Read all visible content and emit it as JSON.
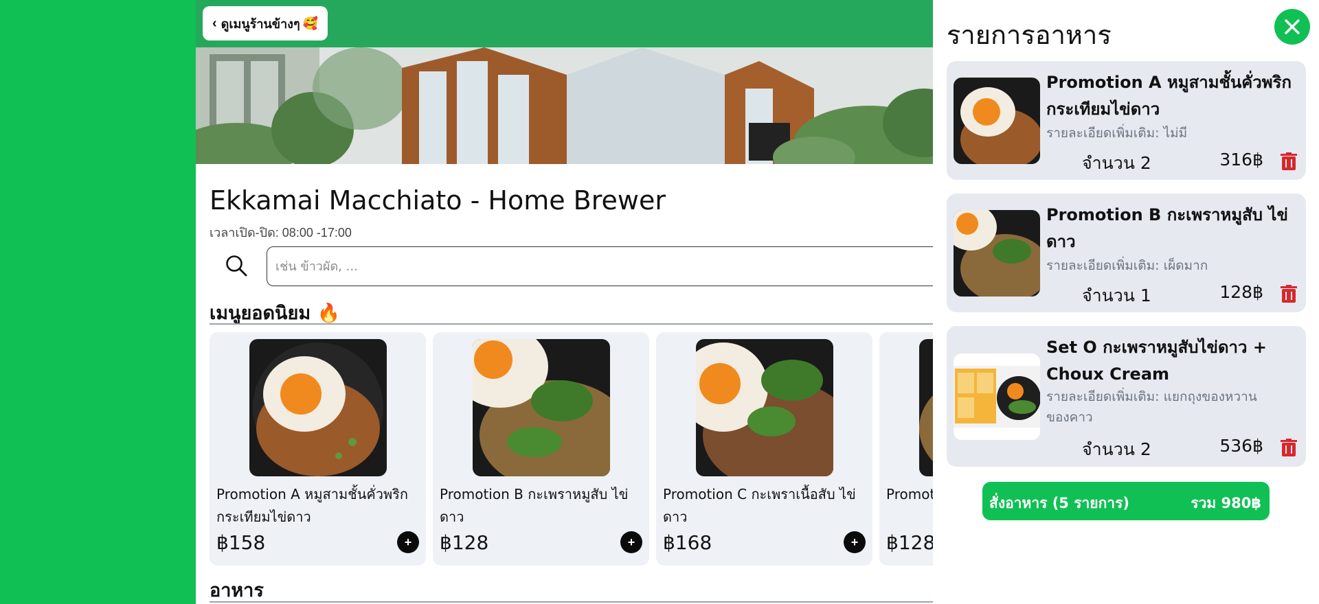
{
  "topbar": {
    "back_label": "ดูเมนูร้านข้างๆ",
    "back_emoji": "🥰"
  },
  "store": {
    "name": "Ekkamai Macchiato - Home Brewer",
    "hours_label": "เวลาเปิด-ปิด:",
    "hours_value": "08:00 -17:00"
  },
  "search": {
    "placeholder": "เช่น ข้าวผัด, ...",
    "icon": "search-icon"
  },
  "sections": {
    "popular_title": "เมนูยอดนิยม",
    "popular_emoji": "🔥",
    "food_title": "อาหาร"
  },
  "popular_items": [
    {
      "name": "Promotion A หมูสามชั้นคั่วพริกกระเทียมไข่ดาว",
      "price": "฿158",
      "add": "+"
    },
    {
      "name": "Promotion B กะเพราหมูสับ ไข่ดาว",
      "price": "฿128",
      "add": "+"
    },
    {
      "name": "Promotion C กะเพราเนื้อสับ ไข่ดาว",
      "price": "฿168",
      "add": "+"
    },
    {
      "name": "Promot ไข่ดาว",
      "price": "฿128",
      "add": "+"
    }
  ],
  "cart": {
    "title": "รายการอาหาร",
    "close_icon": "close-icon",
    "items": [
      {
        "name": "Promotion A หมูสามชั้นคั่วพริกกระเทียมไข่ดาว",
        "detail": "รายละเอียดเพิ่มเติม: ไม่มี",
        "qty": "จำนวน 2",
        "price": "316฿"
      },
      {
        "name": "Promotion B กะเพราหมูสับ ไข่ดาว",
        "detail": "รายละเอียดเพิ่มเติม: เผ็ดมาก",
        "qty": "จำนวน 1",
        "price": "128฿"
      },
      {
        "name": "Set O กะเพราหมูสับไข่ดาว + Choux Cream",
        "detail": "รายละเอียดเพิ่มเติม: แยกถุงของหวานของคาว",
        "qty": "จำนวน 2",
        "price": "536฿"
      }
    ],
    "order_label": "สั่งอาหาร (5 รายการ)",
    "order_total": "รวม 980฿"
  },
  "colors": {
    "accent": "#10c054",
    "header": "#25a85b",
    "trash": "#d6282d"
  }
}
